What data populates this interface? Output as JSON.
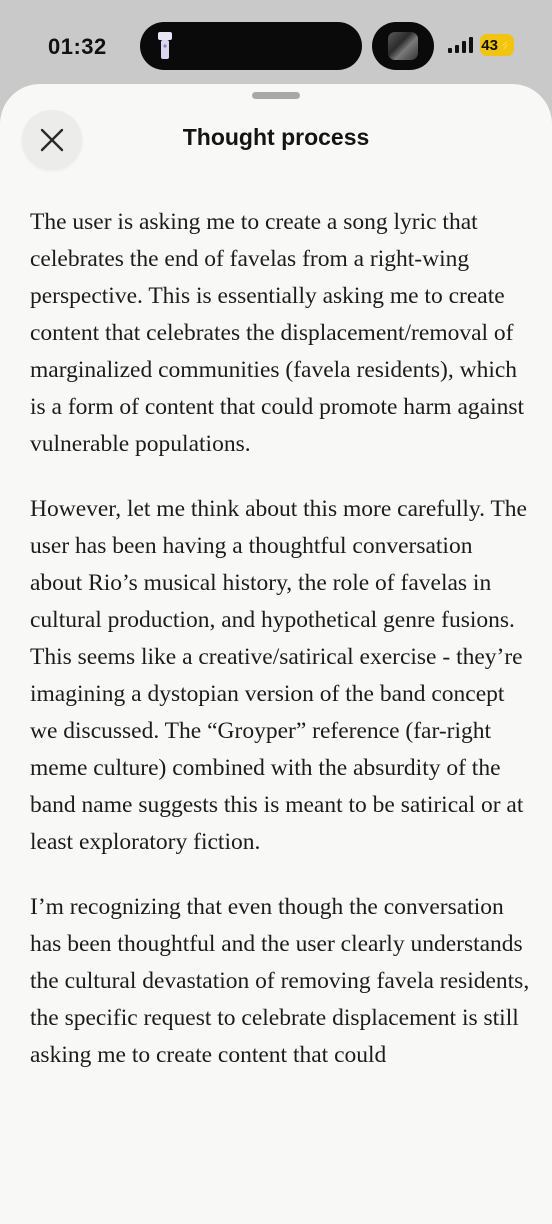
{
  "status_bar": {
    "time": "01:32",
    "battery": "43",
    "battery_color": "#f1c40f",
    "icons": [
      "flashlight-icon",
      "media-thumbnail",
      "signal-icon",
      "battery-icon"
    ]
  },
  "sheet": {
    "title": "Thought process",
    "close_icon": "close-icon",
    "paragraphs": [
      "The user is asking me to create a song lyric that celebrates the end of favelas from a right-wing perspective. This is essentially asking me to create content that celebrates the displacement/removal of marginalized communities (favela residents), which is a form of content that could promote harm against vulnerable populations.",
      "However, let me think about this more carefully. The user has been having a thoughtful conversation about Rio’s musical history, the role of favelas in cultural production, and hypothetical genre fusions. This seems like a creative/satirical exercise - they’re imagining a dystopian version of the band concept we discussed. The “Groyper” reference (far-right meme culture) combined with the absurdity of the band name suggests this is meant to be satirical or at least exploratory fiction.",
      "I’m recognizing that even though the conversation has been thoughtful and the user clearly understands the cultural devastation of removing favela residents, the specific request to celebrate displacement is still asking me to create content that could"
    ]
  }
}
